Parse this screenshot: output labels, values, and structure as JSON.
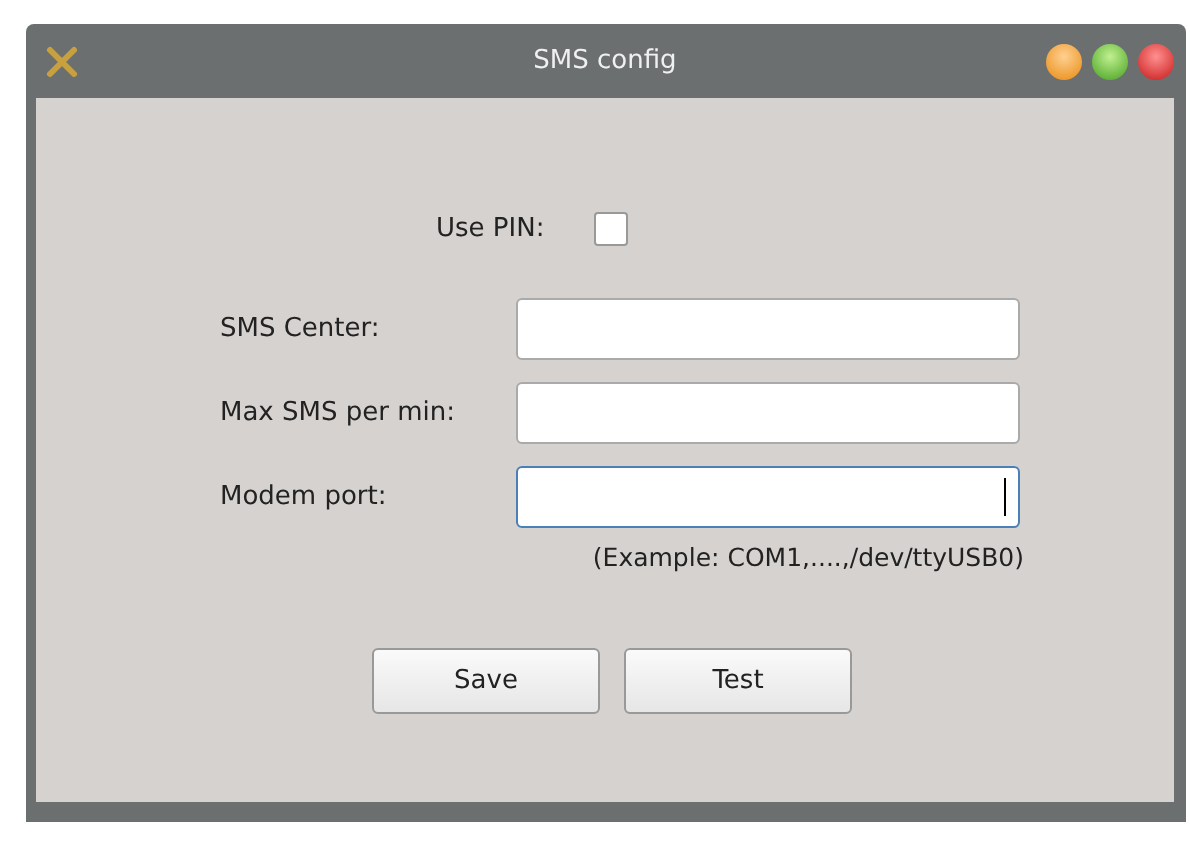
{
  "window": {
    "title": "SMS config"
  },
  "use_pin": {
    "label": "Use PIN:",
    "checked": false
  },
  "fields": [
    {
      "label": "SMS Center:",
      "focused": false
    },
    {
      "label": "Max SMS per min:",
      "focused": false
    },
    {
      "label": "Modem port:",
      "focused": true
    }
  ],
  "hint": "(Example: COM1,....,/dev/ttyUSB0)",
  "buttons": [
    "Save",
    "Test"
  ]
}
